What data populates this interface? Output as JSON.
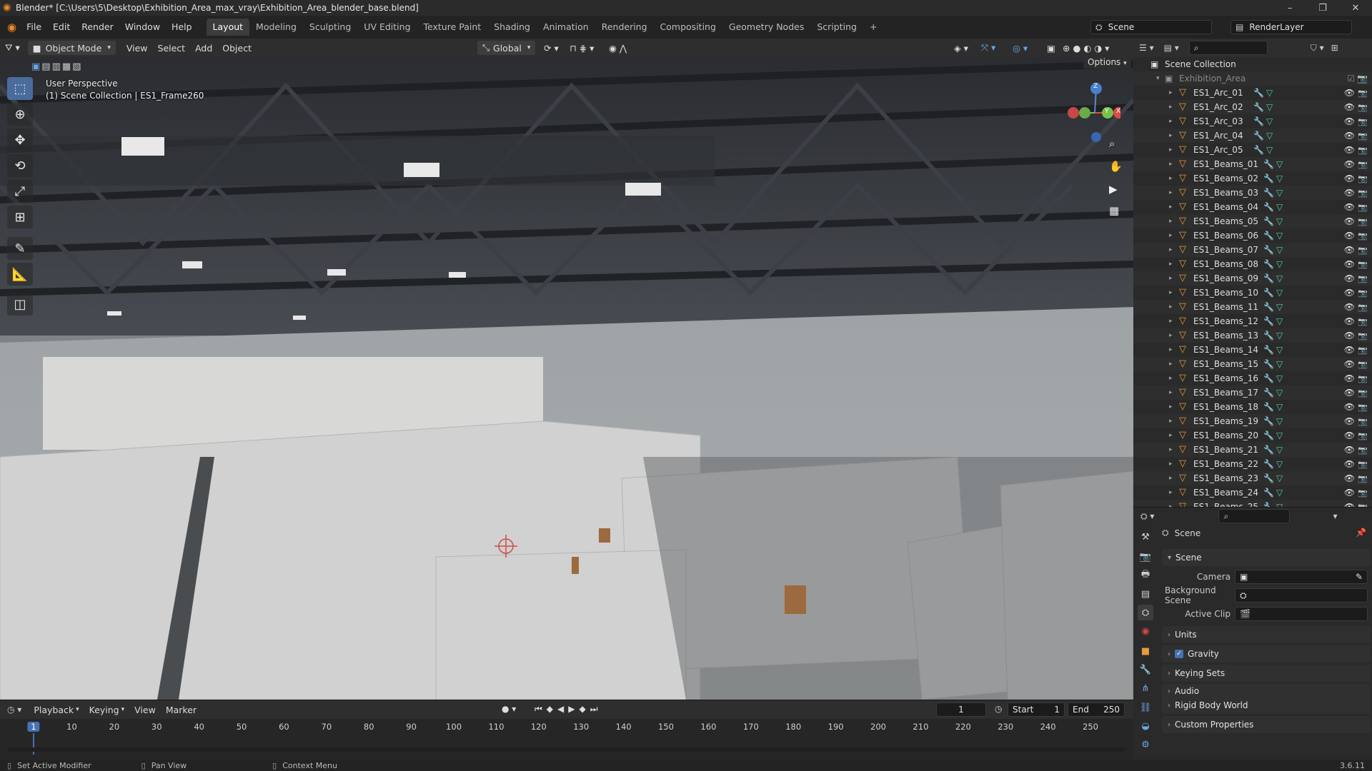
{
  "window": {
    "title": "Blender* [C:\\Users\\5\\Desktop\\Exhibition_Area_max_vray\\Exhibition_Area_blender_base.blend]",
    "min": "–",
    "max": "❐",
    "close": "✕"
  },
  "menu": [
    "File",
    "Edit",
    "Render",
    "Window",
    "Help"
  ],
  "workspaces": [
    "Layout",
    "Modeling",
    "Sculpting",
    "UV Editing",
    "Texture Paint",
    "Shading",
    "Animation",
    "Rendering",
    "Compositing",
    "Geometry Nodes",
    "Scripting",
    "+"
  ],
  "scene_field": "Scene",
  "renderlayer_field": "RenderLayer",
  "viewport_header": {
    "mode": "Object Mode",
    "menus": [
      "View",
      "Select",
      "Add",
      "Object"
    ],
    "orientation": "Global"
  },
  "viewport": {
    "perspective": "User Perspective",
    "collection_info": "(1) Scene Collection | ES1_Frame260",
    "options": "Options",
    "gizmo_labels": {
      "z": "Z",
      "y": "Y",
      "x": "X"
    }
  },
  "outliner": {
    "root": "Scene Collection",
    "collection": "Exhibition_Area",
    "items": [
      "ES1_Arc_01",
      "ES1_Arc_02",
      "ES1_Arc_03",
      "ES1_Arc_04",
      "ES1_Arc_05",
      "ES1_Beams_01",
      "ES1_Beams_02",
      "ES1_Beams_03",
      "ES1_Beams_04",
      "ES1_Beams_05",
      "ES1_Beams_06",
      "ES1_Beams_07",
      "ES1_Beams_08",
      "ES1_Beams_09",
      "ES1_Beams_10",
      "ES1_Beams_11",
      "ES1_Beams_12",
      "ES1_Beams_13",
      "ES1_Beams_14",
      "ES1_Beams_15",
      "ES1_Beams_16",
      "ES1_Beams_17",
      "ES1_Beams_18",
      "ES1_Beams_19",
      "ES1_Beams_20",
      "ES1_Beams_21",
      "ES1_Beams_22",
      "ES1_Beams_23",
      "ES1_Beams_24",
      "ES1_Beams_25"
    ]
  },
  "properties": {
    "context": "Scene",
    "panel": "Scene",
    "fields": [
      {
        "label": "Camera",
        "value": ""
      },
      {
        "label": "Background Scene",
        "value": ""
      },
      {
        "label": "Active Clip",
        "value": ""
      }
    ],
    "subpanels": [
      "Units",
      "Gravity",
      "Keying Sets",
      "Audio",
      "Rigid Body World",
      "Custom Properties"
    ]
  },
  "timeline": {
    "menus": [
      "Playback",
      "Keying",
      "View",
      "Marker"
    ],
    "current_frame": "1",
    "start_label": "Start",
    "start": "1",
    "end_label": "End",
    "end": "250",
    "ticks": [
      "1",
      "10",
      "20",
      "30",
      "40",
      "50",
      "60",
      "70",
      "80",
      "90",
      "100",
      "110",
      "120",
      "130",
      "140",
      "150",
      "160",
      "170",
      "180",
      "190",
      "200",
      "210",
      "220",
      "230",
      "240",
      "250"
    ]
  },
  "status": {
    "left": "Set Active Modifier",
    "mid": "Pan View",
    "right": "Context Menu",
    "version": "3.6.11"
  },
  "colors": {
    "accent": "#4a6b9c",
    "object_icon": "#e89a3c",
    "mesh_icon": "#4fd0a0",
    "modifier_icon": "#6aa6e8",
    "frame_highlight": "#4772b3"
  }
}
